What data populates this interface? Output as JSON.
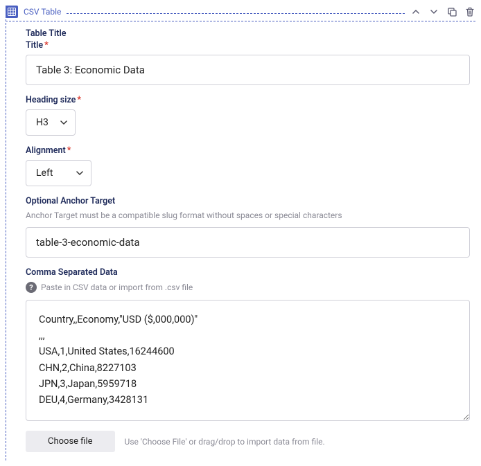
{
  "panel": {
    "title": "CSV Table"
  },
  "sections": {
    "table_title_label": "Table Title",
    "title_label": "Title",
    "title_value": "Table 3: Economic Data",
    "heading_size_label": "Heading size",
    "heading_size_value": "H3",
    "alignment_label": "Alignment",
    "alignment_value": "Left",
    "anchor_label": "Optional Anchor Target",
    "anchor_helper": "Anchor Target must be a compatible slug format without spaces or special characters",
    "anchor_value": "table-3-economic-data",
    "csv_label": "Comma Separated Data",
    "csv_helper": "Paste in CSV data or import from .csv file",
    "csv_value": "Country,,Economy,\"USD ($,000,000)\"\n,,,\nUSA,1,United States,16244600\nCHN,2,China,8227103\nJPN,3,Japan,5959718\nDEU,4,Germany,3428131",
    "choose_file_label": "Choose file",
    "file_helper": "Use 'Choose File' or drag/drop to import data from file."
  }
}
